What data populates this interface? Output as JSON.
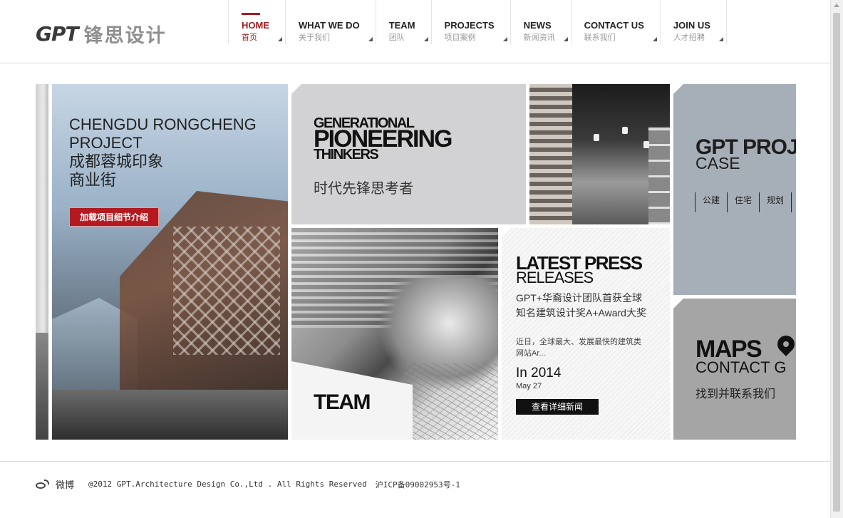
{
  "brand": {
    "mark": "GPT",
    "name_cn": "锋思设计"
  },
  "nav": [
    {
      "en": "HOME",
      "cn": "首页",
      "active": true
    },
    {
      "en": "WHAT WE DO",
      "cn": "关于我们"
    },
    {
      "en": "TEAM",
      "cn": "团队"
    },
    {
      "en": "PROJECTS",
      "cn": "项目案例"
    },
    {
      "en": "NEWS",
      "cn": "新闻资讯"
    },
    {
      "en": "CONTACT US",
      "cn": "联系我们"
    },
    {
      "en": "JOIN US",
      "cn": "人才招聘"
    }
  ],
  "featured": {
    "title_en_1": "CHENGDU RONGCHENG",
    "title_en_2": "PROJECT",
    "title_cn_1": "成都蓉城印象",
    "title_cn_2": "商业街",
    "button": "加载项目细节介绍"
  },
  "generational": {
    "line1": "GENERATIONAL",
    "line2": "PIONEERING",
    "line3": "THINKERS",
    "cn": "时代先锋思考者"
  },
  "gpt_projects": {
    "title": "GPT PROJ",
    "subtitle": "CASE",
    "tags": [
      "公建",
      "住宅",
      "规划"
    ]
  },
  "team": {
    "label": "TEAM"
  },
  "press": {
    "title": "LATEST PRESS",
    "subtitle": "RELEASES",
    "headline": "GPT+华裔设计团队首获全球知名建筑设计奖A+Award大奖",
    "excerpt": "近日，全球最大、发展最快的建筑类网站Ar...",
    "year": "In 2014",
    "date": "May 27",
    "button": "查看详细新闻"
  },
  "maps": {
    "title": "MAPS",
    "subtitle": "CONTACT G",
    "cn": "找到并联系我们"
  },
  "footer": {
    "weibo": "微博",
    "copyright": "@2012 GPT.Architecture Design Co.,Ltd . All Rights Reserved",
    "icp": "沪ICP备09002953号-1"
  },
  "colors": {
    "accent": "#a11d22",
    "button": "#b3191f"
  }
}
